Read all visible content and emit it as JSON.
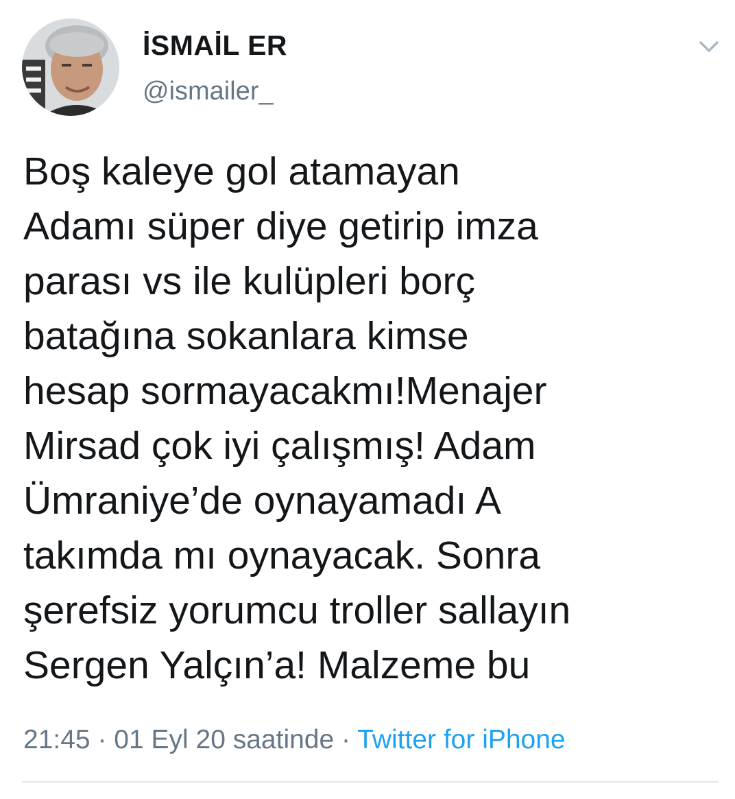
{
  "author": {
    "name": "İSMAİL ER",
    "handle": "@ismailer_",
    "avatar_icon": "profile-photo"
  },
  "menu": {
    "icon": "chevron-down-icon",
    "color": "#aab8c2"
  },
  "tweet": {
    "lines": [
      "Boş kaleye gol atamayan",
      "Adamı süper diye getirip imza",
      "parası vs ile kulüpleri borç",
      "batağına sokanlara kimse",
      "hesap sormayacakmı!Menajer",
      "Mirsad çok iyi çalışmış! Adam",
      "Ümraniye’de oynayamadı A",
      "takımda mı oynayacak. Sonra",
      "şerefsiz yorumcu troller sallayın",
      "Sergen Yalçın’a! Malzeme bu"
    ]
  },
  "meta": {
    "time": "21:45",
    "separator": " · ",
    "date": "01 Eyl 20 saatinde",
    "separator2": " · ",
    "source": "Twitter for iPhone"
  },
  "colors": {
    "text": "#14171a",
    "secondary": "#657786",
    "link": "#1da1f2",
    "divider": "#e1e8ed"
  }
}
